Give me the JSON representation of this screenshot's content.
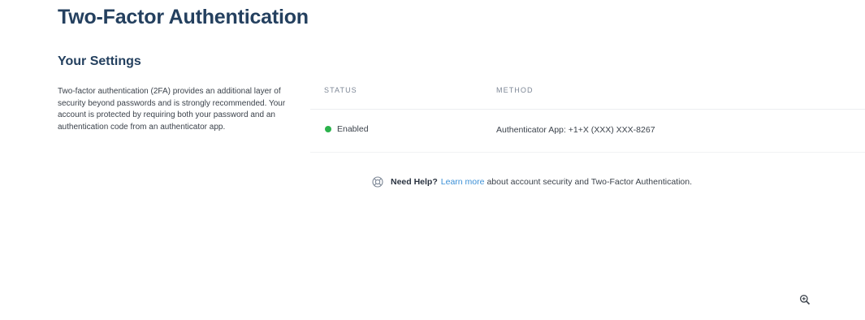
{
  "page": {
    "title": "Two-Factor Authentication"
  },
  "settings": {
    "section_title": "Your Settings",
    "description": "Two-factor authentication (2FA) provides an additional layer of security beyond passwords and is strongly recommended. Your account is protected by requiring both your password and an authentication code from an authenticator app.",
    "table": {
      "headers": {
        "status": "STATUS",
        "method": "METHOD"
      },
      "rows": [
        {
          "status": "Enabled",
          "status_color": "#2bb24c",
          "method": "Authenticator App: +1+X (XXX) XXX-8267"
        }
      ]
    }
  },
  "help": {
    "icon": "lifebuoy-icon",
    "bold_text": "Need Help?",
    "link_text": "Learn more",
    "suffix_text": "about account security and Two-Factor Authentication."
  },
  "corner": {
    "icon": "zoom-in-icon"
  },
  "colors": {
    "heading": "#24405f",
    "link": "#3a8fd6",
    "status_enabled": "#2bb24c"
  }
}
